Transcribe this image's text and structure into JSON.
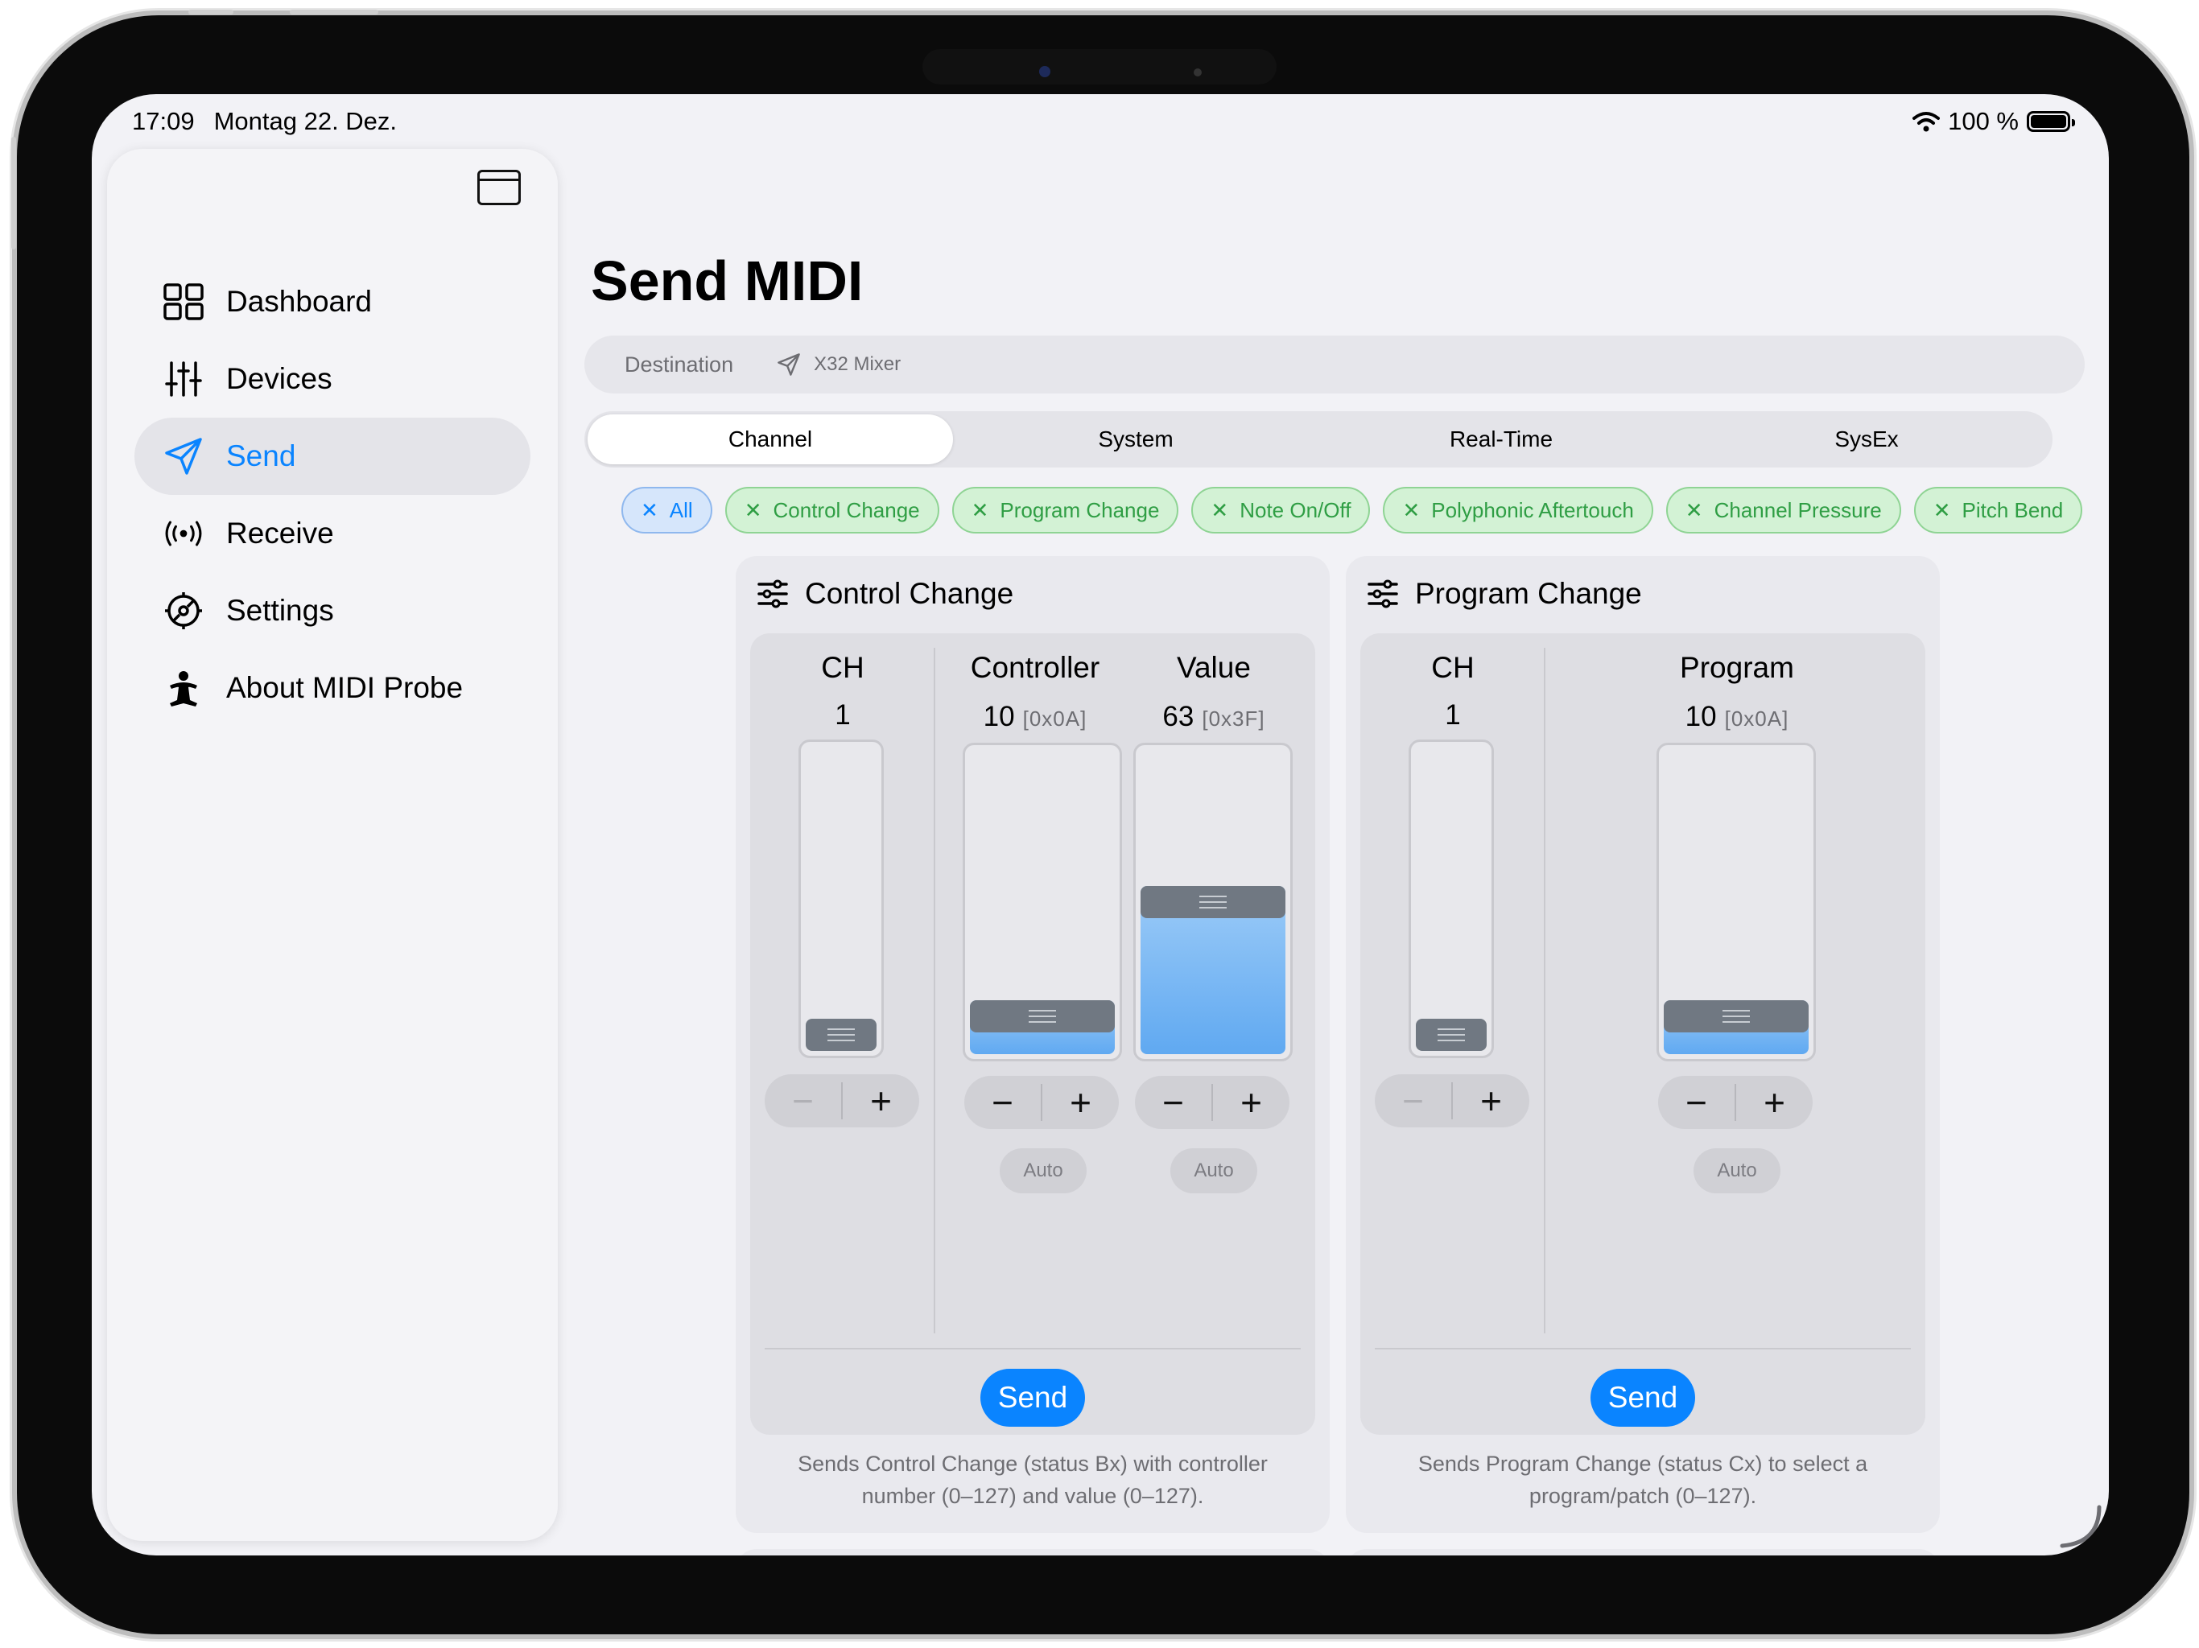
{
  "status_bar": {
    "time": "17:09",
    "date": "Montag 22. Dez.",
    "battery": "100 %"
  },
  "sidebar": {
    "items": [
      {
        "label": "Dashboard",
        "icon": "grid-icon"
      },
      {
        "label": "Devices",
        "icon": "sliders-icon"
      },
      {
        "label": "Send",
        "icon": "paperplane-icon",
        "active": true
      },
      {
        "label": "Receive",
        "icon": "antenna-icon"
      },
      {
        "label": "Settings",
        "icon": "gear-icon"
      },
      {
        "label": "About MIDI Probe",
        "icon": "figure-icon"
      }
    ]
  },
  "main": {
    "title": "Send MIDI",
    "destination": {
      "label": "Destination",
      "value": "X32 Mixer"
    },
    "tabs": [
      "Channel",
      "System",
      "Real-Time",
      "SysEx"
    ],
    "active_tab": "Channel",
    "filters": [
      "All",
      "Control Change",
      "Program Change",
      "Note On/Off",
      "Polyphonic Aftertouch",
      "Channel Pressure",
      "Pitch Bend"
    ]
  },
  "cards": {
    "cc": {
      "title": "Control Change",
      "ch": {
        "label": "CH",
        "value": "1",
        "level": 0.0
      },
      "controller": {
        "label": "Controller",
        "value": "10",
        "hex": "[0x0A]",
        "level": 0.08
      },
      "value": {
        "label": "Value",
        "value": "63",
        "hex": "[0x3F]",
        "level": 0.5
      },
      "auto_label": "Auto",
      "send_label": "Send",
      "description": "Sends Control Change (status Bx) with controller number (0–127) and value (0–127)."
    },
    "pc": {
      "title": "Program Change",
      "ch": {
        "label": "CH",
        "value": "1",
        "level": 0.0
      },
      "program": {
        "label": "Program",
        "value": "10",
        "hex": "[0x0A]",
        "level": 0.08
      },
      "auto_label": "Auto",
      "send_label": "Send",
      "description": "Sends Program Change (status Cx) to select a program/patch (0–127)."
    }
  },
  "colors": {
    "accent": "#0a84ff",
    "chip_green": "#2f9e44",
    "slider_fill": "#60a9f1"
  }
}
